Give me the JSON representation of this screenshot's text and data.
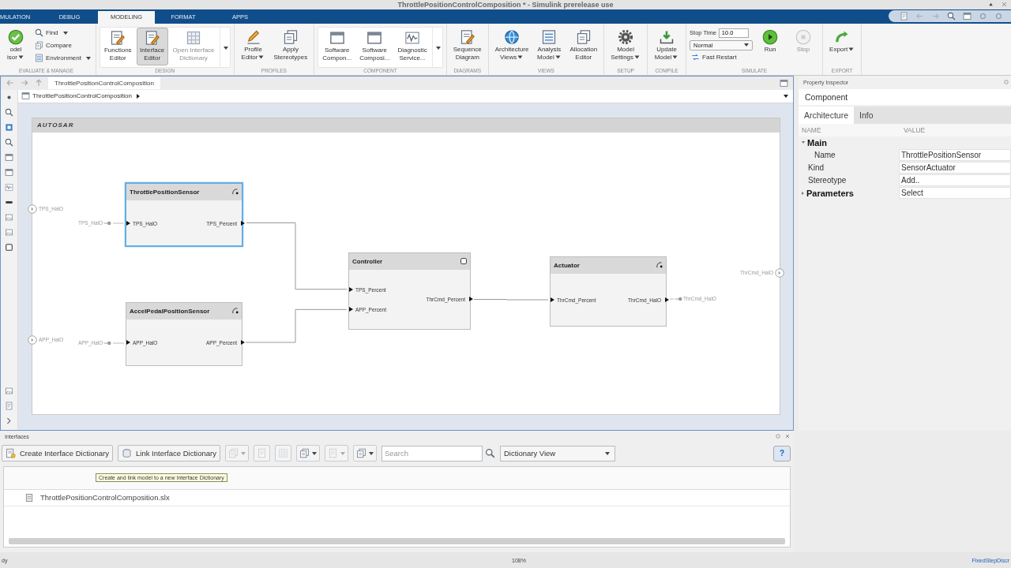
{
  "window": {
    "title": "ThrottlePositionControlComposition * - Simulink prerelease use"
  },
  "ribbon_tabs": [
    {
      "label": "MULATION",
      "selected": false
    },
    {
      "label": "DEBUG",
      "selected": false
    },
    {
      "label": "MODELING",
      "selected": true
    },
    {
      "label": "FORMAT",
      "selected": false
    },
    {
      "label": "APPS",
      "selected": false
    }
  ],
  "ribbon_groups": [
    {
      "label": "EVALUATE & MANAGE",
      "items": [
        {
          "kind": "large",
          "lines": [
            "odel",
            "isor"
          ],
          "menu": true,
          "selected": false,
          "disabled": false
        },
        {
          "kind": "stack",
          "items": [
            {
              "kind": "small",
              "label": "Find",
              "menu": true
            },
            {
              "kind": "small",
              "label": "Compare",
              "menu": false
            },
            {
              "kind": "small",
              "label": "Environment",
              "menu": true
            }
          ]
        }
      ]
    },
    {
      "label": "DESIGN",
      "items": [
        {
          "kind": "gallery",
          "items": [
            {
              "kind": "large",
              "lines": [
                "Functions",
                "Editor"
              ],
              "menu": false,
              "selected": false,
              "disabled": false
            },
            {
              "kind": "large",
              "lines": [
                "Interface",
                "Editor"
              ],
              "menu": false,
              "selected": true,
              "disabled": false
            },
            {
              "kind": "large",
              "lines": [
                "Open Interface",
                "Dictionary"
              ],
              "menu": false,
              "selected": false,
              "disabled": true
            }
          ]
        }
      ]
    },
    {
      "label": "PROFILES",
      "items": [
        {
          "kind": "large",
          "lines": [
            "Profile",
            "Editor"
          ],
          "menu": true,
          "selected": false,
          "disabled": false
        },
        {
          "kind": "large",
          "lines": [
            "Apply",
            "Stereotypes"
          ],
          "menu": false,
          "selected": false,
          "disabled": false
        }
      ]
    },
    {
      "label": "COMPONENT",
      "items": [
        {
          "kind": "gallery",
          "items": [
            {
              "kind": "large",
              "lines": [
                "Software",
                "Compon..."
              ],
              "menu": false,
              "selected": false,
              "disabled": false
            },
            {
              "kind": "large",
              "lines": [
                "Software",
                "Composi..."
              ],
              "menu": false,
              "selected": false,
              "disabled": false
            },
            {
              "kind": "large",
              "lines": [
                "Diagnostic",
                "Service..."
              ],
              "menu": false,
              "selected": false,
              "disabled": false
            }
          ]
        }
      ]
    },
    {
      "label": "DIAGRAMS",
      "items": [
        {
          "kind": "large",
          "lines": [
            "Sequence",
            "Diagram"
          ],
          "menu": false,
          "selected": false,
          "disabled": false
        }
      ]
    },
    {
      "label": "VIEWS",
      "items": [
        {
          "kind": "large",
          "lines": [
            "Architecture",
            "Views"
          ],
          "menu": true,
          "selected": false,
          "disabled": false
        },
        {
          "kind": "large",
          "lines": [
            "Analysis",
            "Model"
          ],
          "menu": true,
          "selected": false,
          "disabled": false
        },
        {
          "kind": "large",
          "lines": [
            "Allocation",
            "Editor"
          ],
          "menu": false,
          "selected": false,
          "disabled": false
        }
      ]
    },
    {
      "label": "SETUP",
      "items": [
        {
          "kind": "large",
          "lines": [
            "Model",
            "Settings"
          ],
          "menu": true,
          "selected": false,
          "disabled": false
        }
      ]
    },
    {
      "label": "COMPILE",
      "items": [
        {
          "kind": "large",
          "lines": [
            "Update",
            "Model"
          ],
          "menu": true,
          "selected": false,
          "disabled": false
        }
      ]
    },
    {
      "label": "SIMULATE",
      "items": [
        {
          "kind": "stack",
          "items": [
            {
              "kind": "field",
              "label": "Stop Time",
              "value": "10.0"
            },
            {
              "kind": "select",
              "value": "Normal"
            },
            {
              "kind": "small",
              "label": "Fast Restart",
              "menu": false
            }
          ]
        },
        {
          "kind": "large",
          "lines": [
            "Run"
          ],
          "menu": false,
          "selected": false,
          "disabled": false
        },
        {
          "kind": "large",
          "lines": [
            "Stop"
          ],
          "menu": false,
          "selected": false,
          "disabled": true
        }
      ]
    },
    {
      "label": "EXPORT",
      "items": [
        {
          "kind": "large",
          "lines": [
            "Export"
          ],
          "menu": true,
          "selected": false,
          "disabled": false
        }
      ]
    }
  ],
  "editor": {
    "tabs": [
      {
        "label": "ThrottlePositionControlComposition",
        "selected": true
      }
    ],
    "breadcrumb": [
      "ThrottlePositionControlComposition"
    ]
  },
  "diagram": {
    "logo": "AUTOSAR",
    "external_ports": [
      {
        "label": "TPS_HalO",
        "kind": "inport"
      },
      {
        "label": "APP_HalO",
        "kind": "inport"
      },
      {
        "label": "ThrCmd_HalO",
        "kind": "outport"
      }
    ],
    "bus_elements": [
      {
        "label": "TPS_HalO"
      },
      {
        "label": "APP_HalO"
      },
      {
        "label": "ThrCmd_HalO"
      }
    ],
    "blocks": [
      {
        "name": "ThrottlePositionSensor",
        "kind": "sensor_actuator",
        "selected": true,
        "inputs": [
          "TPS_HalO"
        ],
        "outputs": [
          "TPS_Percent"
        ]
      },
      {
        "name": "AccelPedalPositionSensor",
        "kind": "sensor_actuator",
        "selected": false,
        "inputs": [
          "APP_HalO"
        ],
        "outputs": [
          "APP_Percent"
        ]
      },
      {
        "name": "Controller",
        "kind": "application",
        "selected": false,
        "inputs": [
          "TPS_Percent",
          "APP_Percent"
        ],
        "outputs": [
          "ThrCmd_Percent"
        ]
      },
      {
        "name": "Actuator",
        "kind": "sensor_actuator",
        "selected": false,
        "inputs": [
          "ThrCmd_Percent"
        ],
        "outputs": [
          "ThrCmd_HalO"
        ]
      }
    ]
  },
  "property_inspector": {
    "title": "Property Inspector",
    "heading": "Component",
    "tabs": [
      {
        "label": "Architecture",
        "selected": true
      },
      {
        "label": "Info",
        "selected": false
      }
    ],
    "columns": [
      "NAME",
      "VALUE"
    ],
    "rows": [
      {
        "kind": "group",
        "name": "Main",
        "expanded": true,
        "children": [
          {
            "kind": "property",
            "name": "Name",
            "value": "ThrottlePositionSensor"
          }
        ]
      },
      {
        "kind": "property",
        "name": "Kind",
        "value": "SensorActuator"
      },
      {
        "kind": "property",
        "name": "Stereotype",
        "value": "Add.."
      },
      {
        "kind": "group",
        "name": "Parameters",
        "expanded": false,
        "value": "Select"
      }
    ]
  },
  "interfaces": {
    "title": "Interfaces",
    "buttons": [
      {
        "label": "Create Interface Dictionary"
      },
      {
        "label": "Link Interface Dictionary"
      }
    ],
    "tools": [
      {
        "disabled": true,
        "menu": true
      },
      {
        "disabled": true,
        "menu": false
      },
      {
        "disabled": true,
        "menu": false
      },
      {
        "disabled": false,
        "menu": true
      },
      {
        "disabled": true,
        "menu": true
      },
      {
        "disabled": false,
        "menu": true
      }
    ],
    "search": {
      "placeholder": "Search"
    },
    "view": {
      "value": "Dictionary View"
    },
    "help": "?",
    "tooltip": "Create and link model to a new Interface Dictionary",
    "rows": [
      {
        "name": "ThrottlePositionControlComposition.slx"
      }
    ]
  },
  "status_bar": {
    "left": "dy",
    "zoom": "108%",
    "right": "FixedStepDiscr"
  }
}
